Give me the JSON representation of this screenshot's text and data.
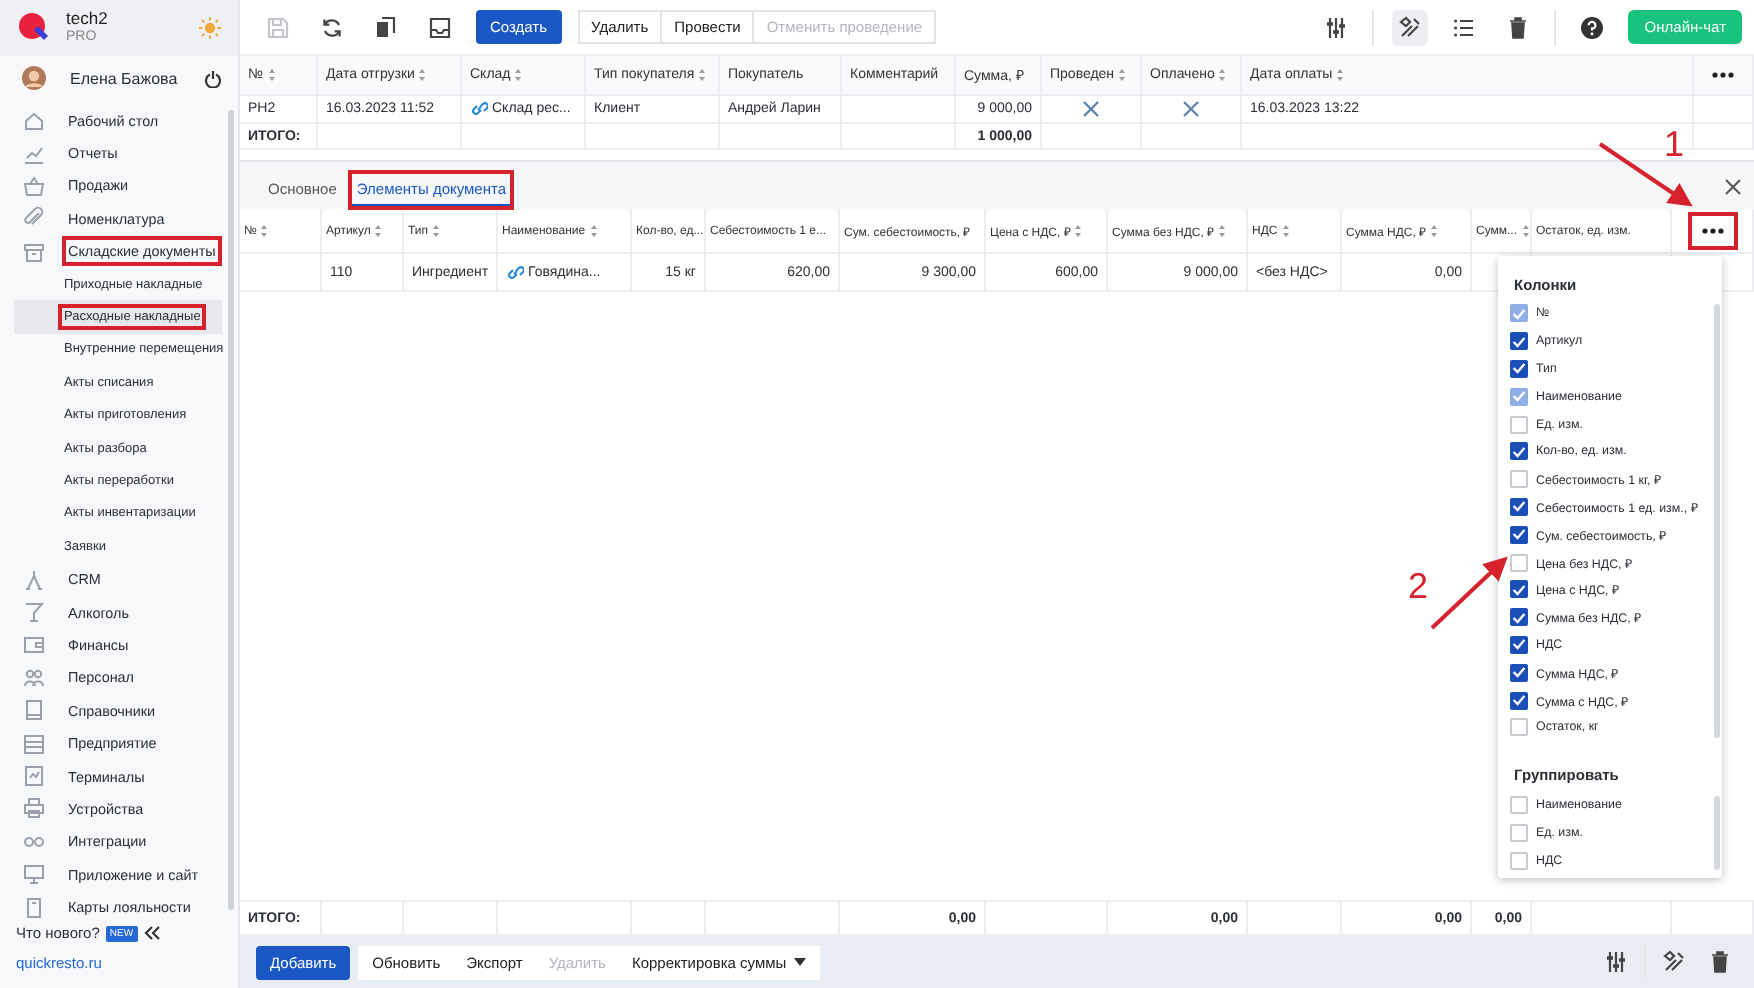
{
  "app": {
    "name": "tech2",
    "plan": "PRO"
  },
  "user": {
    "name": "Елена Бажова"
  },
  "sidebar": {
    "items": [
      {
        "label": "Рабочий стол",
        "selected": false
      },
      {
        "label": "Отчеты",
        "selected": false
      },
      {
        "label": "Продажи",
        "selected": false
      },
      {
        "label": "Номенклатура",
        "selected": false
      },
      {
        "label": "Складские документы",
        "selected": false,
        "highlighted": true,
        "expanded": true,
        "children": [
          {
            "label": "Приходные накладные",
            "selected": false
          },
          {
            "label": "Расходные накладные",
            "selected": true,
            "highlighted": true
          },
          {
            "label": "Внутренние перемещения",
            "selected": false
          },
          {
            "label": "Акты списания",
            "selected": false
          },
          {
            "label": "Акты приготовления",
            "selected": false
          },
          {
            "label": "Акты разбора",
            "selected": false
          },
          {
            "label": "Акты переработки",
            "selected": false
          },
          {
            "label": "Акты инвентаризации",
            "selected": false
          },
          {
            "label": "Заявки",
            "selected": false
          }
        ]
      },
      {
        "label": "CRM",
        "selected": false
      },
      {
        "label": "Алкоголь",
        "selected": false
      },
      {
        "label": "Финансы",
        "selected": false
      },
      {
        "label": "Персонал",
        "selected": false
      },
      {
        "label": "Справочники",
        "selected": false
      },
      {
        "label": "Предприятие",
        "selected": false
      },
      {
        "label": "Терминалы",
        "selected": false
      },
      {
        "label": "Устройства",
        "selected": false
      },
      {
        "label": "Интеграции",
        "selected": false
      },
      {
        "label": "Приложение и сайт",
        "selected": false
      },
      {
        "label": "Карты лояльности",
        "selected": false
      }
    ]
  },
  "whats_new": {
    "label": "Что нового?",
    "badge": "NEW"
  },
  "site_link": "quickresto.ru",
  "toolbar": {
    "buttons": [
      {
        "label": "Создать",
        "kind": "primary",
        "disabled": false
      },
      {
        "label": "Удалить",
        "kind": "plain",
        "disabled": false
      },
      {
        "label": "Провести",
        "kind": "plain",
        "disabled": false
      },
      {
        "label": "Отменить проведение",
        "kind": "plain",
        "disabled": true
      }
    ],
    "chat_button": "Онлайн-чат"
  },
  "documents_table": {
    "columns": [
      {
        "label": "№",
        "sortable": true
      },
      {
        "label": "Дата отгрузки",
        "sortable": true
      },
      {
        "label": "Склад",
        "sortable": true
      },
      {
        "label": "Тип покупателя",
        "sortable": true
      },
      {
        "label": "Покупатель"
      },
      {
        "label": "Комментарий"
      },
      {
        "label": "Сумма, ₽"
      },
      {
        "label": "Проведен",
        "sortable": true
      },
      {
        "label": "Оплачено",
        "sortable": true
      },
      {
        "label": "Дата оплаты",
        "sortable": true
      }
    ],
    "rows": [
      {
        "cells": [
          {
            "kind": "text",
            "text": "РН2"
          },
          {
            "kind": "text",
            "text": "16.03.2023 11:52"
          },
          {
            "kind": "link",
            "text": "Склад рес..."
          },
          {
            "kind": "text",
            "text": "Клиент"
          },
          {
            "kind": "text",
            "text": "Андрей Ларин"
          },
          {
            "kind": "empty"
          },
          {
            "kind": "number",
            "text": "9 000,00"
          },
          {
            "kind": "flag",
            "checked": false
          },
          {
            "kind": "flag",
            "checked": false
          },
          {
            "kind": "text",
            "text": "16.03.2023 13:22"
          }
        ]
      }
    ],
    "total": [
      {
        "kind": "label",
        "text": "ИТОГО:"
      },
      {
        "kind": "empty"
      },
      {
        "kind": "empty"
      },
      {
        "kind": "empty"
      },
      {
        "kind": "empty"
      },
      {
        "kind": "empty"
      },
      {
        "kind": "number",
        "text": "1 000,00"
      },
      {
        "kind": "empty"
      },
      {
        "kind": "empty"
      },
      {
        "kind": "empty"
      }
    ]
  },
  "tabs": [
    {
      "label": "Основное",
      "selected": false
    },
    {
      "label": "Элементы документа",
      "selected": true,
      "highlighted": true
    }
  ],
  "items_table": {
    "columns": [
      {
        "label": "№",
        "sortable": true
      },
      {
        "label": "Артикул",
        "sortable": true
      },
      {
        "label": "Тип",
        "sortable": true
      },
      {
        "label": "Наименование",
        "sortable": true
      },
      {
        "label": "Кол-во, ед..."
      },
      {
        "label": "Себестоимость 1 е..."
      },
      {
        "label": "Сум. себестоимость, ₽"
      },
      {
        "label": "Цена с НДС, ₽",
        "sortable": true
      },
      {
        "label": "Сумма без НДС, ₽",
        "sortable": true
      },
      {
        "label": "НДС",
        "sortable": true
      },
      {
        "label": "Сумма НДС, ₽",
        "sortable": true
      },
      {
        "label": "Сумм...",
        "sortable": true
      },
      {
        "label": "Остаток, ед. изм."
      }
    ],
    "columns_button": {
      "highlighted": true
    },
    "rows": [
      {
        "cells": [
          {
            "kind": "empty"
          },
          {
            "kind": "text",
            "text": "110"
          },
          {
            "kind": "text",
            "text": "Ингредиент"
          },
          {
            "kind": "link",
            "text": "Говядина..."
          },
          {
            "kind": "number",
            "text": "15 кг"
          },
          {
            "kind": "number",
            "text": "620,00"
          },
          {
            "kind": "number",
            "text": "9 300,00"
          },
          {
            "kind": "number",
            "text": "600,00"
          },
          {
            "kind": "number",
            "text": "9 000,00"
          },
          {
            "kind": "text",
            "text": "<без НДС>"
          },
          {
            "kind": "number",
            "text": "0,00"
          },
          {
            "kind": "empty"
          },
          {
            "kind": "empty"
          }
        ]
      }
    ],
    "total": [
      {
        "kind": "label",
        "text": "ИТОГО:"
      },
      {
        "kind": "empty"
      },
      {
        "kind": "empty"
      },
      {
        "kind": "empty"
      },
      {
        "kind": "empty"
      },
      {
        "kind": "empty"
      },
      {
        "kind": "number",
        "text": "0,00"
      },
      {
        "kind": "empty"
      },
      {
        "kind": "number",
        "text": "0,00"
      },
      {
        "kind": "empty"
      },
      {
        "kind": "number",
        "text": "0,00"
      },
      {
        "kind": "number",
        "text": "0,00"
      },
      {
        "kind": "empty"
      }
    ]
  },
  "column_menu": {
    "sections": [
      {
        "title": "Колонки",
        "items": [
          {
            "label": "№",
            "checked": true,
            "disabled": true
          },
          {
            "label": "Артикул",
            "checked": true,
            "disabled": false
          },
          {
            "label": "Тип",
            "checked": true,
            "disabled": false
          },
          {
            "label": "Наименование",
            "checked": true,
            "disabled": true
          },
          {
            "label": "Ед. изм.",
            "checked": false,
            "disabled": false
          },
          {
            "label": "Кол-во, ед. изм.",
            "checked": true,
            "disabled": false
          },
          {
            "label": "Себестоимость 1 кг, ₽",
            "checked": false,
            "disabled": false
          },
          {
            "label": "Себестоимость 1 ед. изм., ₽",
            "checked": true,
            "disabled": false
          },
          {
            "label": "Сум. себестоимость, ₽",
            "checked": true,
            "disabled": false
          },
          {
            "label": "Цена без НДС, ₽",
            "checked": false,
            "disabled": false
          },
          {
            "label": "Цена с НДС, ₽",
            "checked": true,
            "disabled": false
          },
          {
            "label": "Сумма без НДС, ₽",
            "checked": true,
            "disabled": false
          },
          {
            "label": "НДС",
            "checked": true,
            "disabled": false
          },
          {
            "label": "Сумма НДС, ₽",
            "checked": true,
            "disabled": false
          },
          {
            "label": "Сумма с НДС, ₽",
            "checked": true,
            "disabled": false
          },
          {
            "label": "Остаток, кг",
            "checked": false,
            "disabled": false
          }
        ]
      },
      {
        "title": "Группировать",
        "items": [
          {
            "label": "Наименование",
            "checked": false,
            "disabled": false
          },
          {
            "label": "Ед. изм.",
            "checked": false,
            "disabled": false
          },
          {
            "label": "НДС",
            "checked": false,
            "disabled": false
          }
        ]
      }
    ]
  },
  "bottom_toolbar": {
    "buttons": [
      {
        "label": "Добавить",
        "kind": "primary",
        "disabled": false
      },
      {
        "label": "Обновить",
        "kind": "plain",
        "disabled": false
      },
      {
        "label": "Экспорт",
        "kind": "plain",
        "disabled": false
      },
      {
        "label": "Удалить",
        "kind": "plain",
        "disabled": true
      },
      {
        "label": "Корректировка суммы",
        "kind": "menu",
        "disabled": false
      }
    ]
  },
  "annotations": [
    {
      "text": "1"
    },
    {
      "text": "2"
    }
  ]
}
